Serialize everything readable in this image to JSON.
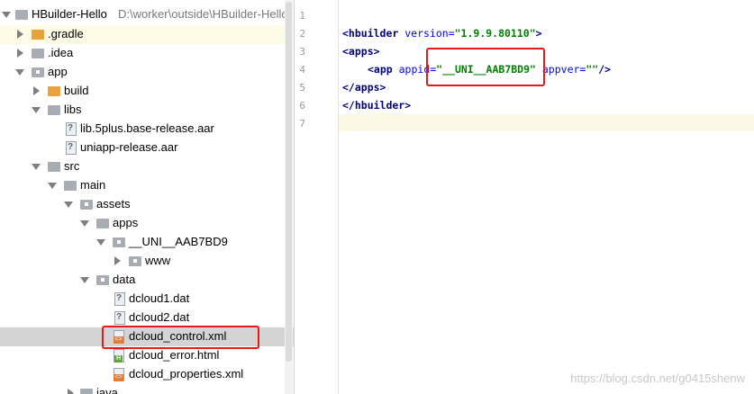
{
  "project": {
    "name": "HBuilder-Hello",
    "path": "D:\\worker\\outside\\HBuilder-Hello"
  },
  "tree": {
    "items": [
      {
        "label": "HBuilder-Hello",
        "icon": "project-folder-icon"
      },
      {
        "label": ".gradle",
        "icon": "folder-icon"
      },
      {
        "label": ".idea",
        "icon": "folder-icon"
      },
      {
        "label": "app",
        "icon": "module-folder-icon"
      },
      {
        "label": "build",
        "icon": "folder-icon"
      },
      {
        "label": "libs",
        "icon": "folder-icon"
      },
      {
        "label": "lib.5plus.base-release.aar",
        "icon": "aar-file-icon"
      },
      {
        "label": "uniapp-release.aar",
        "icon": "aar-file-icon"
      },
      {
        "label": "src",
        "icon": "folder-icon"
      },
      {
        "label": "main",
        "icon": "folder-icon"
      },
      {
        "label": "assets",
        "icon": "assets-folder-icon"
      },
      {
        "label": "apps",
        "icon": "folder-icon"
      },
      {
        "label": "__UNI__AAB7BD9",
        "icon": "folder-icon"
      },
      {
        "label": "www",
        "icon": "folder-icon"
      },
      {
        "label": "data",
        "icon": "folder-icon"
      },
      {
        "label": "dcloud1.dat",
        "icon": "unknown-file-icon"
      },
      {
        "label": "dcloud2.dat",
        "icon": "unknown-file-icon"
      },
      {
        "label": "dcloud_control.xml",
        "icon": "xml-file-icon"
      },
      {
        "label": "dcloud_error.html",
        "icon": "html-file-icon"
      },
      {
        "label": "dcloud_properties.xml",
        "icon": "xml-file-icon"
      },
      {
        "label": "java",
        "icon": "folder-icon"
      }
    ]
  },
  "editor": {
    "line_numbers": [
      "1",
      "2",
      "3",
      "4",
      "5",
      "6",
      "7"
    ],
    "code": {
      "l2_open": "<hbuilder",
      "l2_attr": " version=",
      "l2_val": "\"1.9.9.80110\"",
      "l2_close": ">",
      "l3": "<apps>",
      "l4_open": "<app",
      "l4_attr1": " appid=",
      "l4_val1": "\"__UNI__AAB7BD9\"",
      "l4_attr2": " appver=",
      "l4_val2": "\"\"",
      "l4_close": "/>",
      "l5": "</apps>",
      "l6": "</hbuilder>"
    }
  },
  "watermark": "https://blog.csdn.net/g0415shenw",
  "colors": {
    "highlight_red": "#e51a1a",
    "folder_orange": "#e9a23b",
    "xml_tag": "#000080",
    "xml_attr": "#0000ff",
    "xml_value": "#008000"
  }
}
